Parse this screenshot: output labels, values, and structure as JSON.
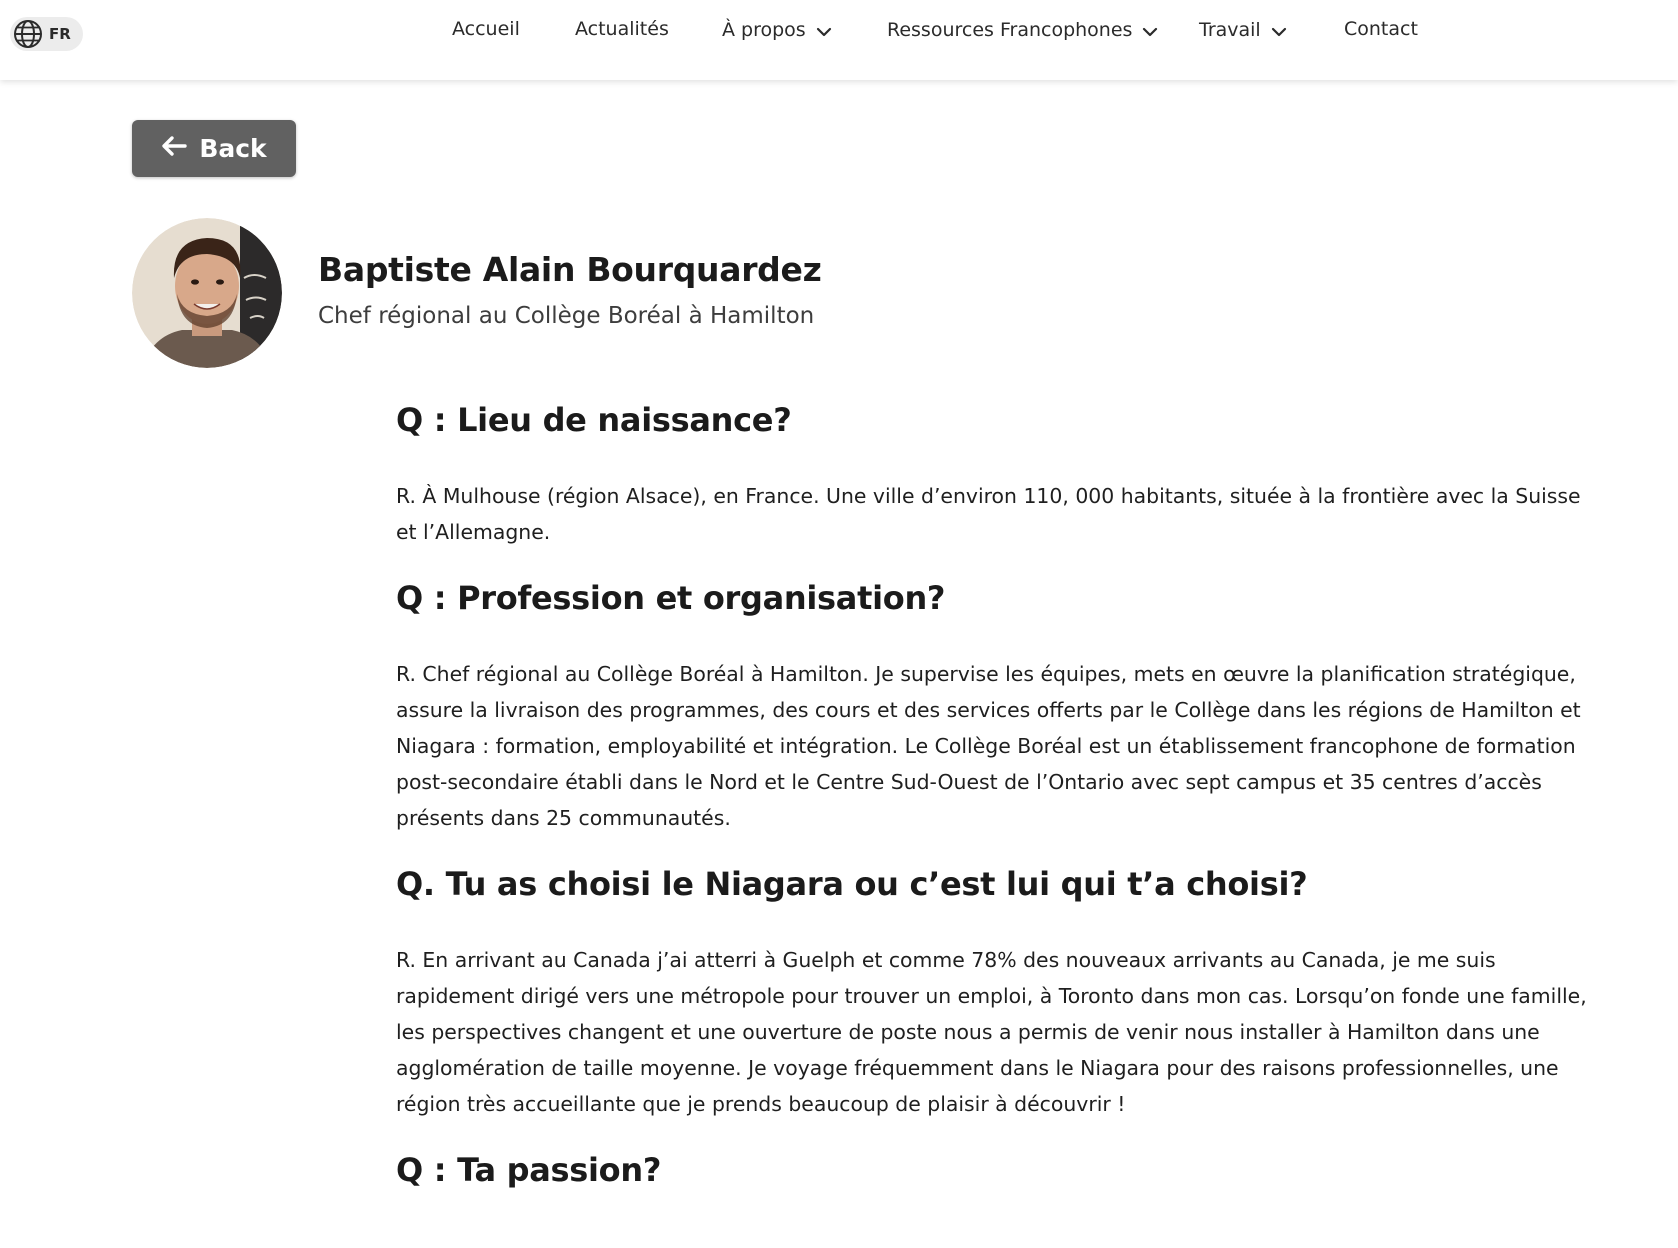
{
  "header": {
    "language": {
      "code": "FR",
      "icon": "globe-icon"
    },
    "nav": [
      {
        "label": "Accueil",
        "has_dropdown": false
      },
      {
        "label": "Actualités",
        "has_dropdown": false
      },
      {
        "label": "À propos",
        "has_dropdown": true
      },
      {
        "label": "Ressources Francophones",
        "has_dropdown": true
      },
      {
        "label": "Travail",
        "has_dropdown": true
      },
      {
        "label": "Contact",
        "has_dropdown": false
      }
    ]
  },
  "back_button": {
    "label": "Back",
    "icon": "arrow-left-icon"
  },
  "profile": {
    "name": "Baptiste Alain Bourquardez",
    "role": "Chef régional au Collège Boréal à Hamilton"
  },
  "qa": [
    {
      "question": "Q : Lieu de naissance?",
      "answer": "R. À Mulhouse (région Alsace), en France. Une ville d’environ 110, 000 habitants, située à la frontière avec la Suisse et l’Allemagne."
    },
    {
      "question": "Q : Profession et organisation?",
      "answer": "R. Chef régional au Collège Boréal à Hamilton. Je supervise les équipes, mets en œuvre la planification stratégique, assure la livraison des programmes, des cours et des services offerts par le Collège dans les régions de Hamilton et Niagara : formation, employabilité et intégration. Le Collège Boréal est un établissement francophone de formation post-secondaire établi dans le Nord et le Centre Sud-Ouest de l’Ontario avec sept campus et 35 centres d’accès présents dans 25 communautés."
    },
    {
      "question": "Q. Tu as choisi le Niagara ou c’est lui qui t’a choisi?",
      "answer": "R. En arrivant au Canada j’ai atterri à Guelph et comme 78% des nouveaux arrivants au Canada, je me suis rapidement dirigé vers une métropole pour trouver un emploi, à Toronto dans mon cas. Lorsqu’on fonde une famille, les perspectives changent et une ouverture de poste nous a permis de venir nous installer à Hamilton dans une agglomération de taille moyenne. Je voyage fréquemment dans le Niagara pour des raisons professionnelles, une région très accueillante que je prends beaucoup de plaisir à découvrir !"
    },
    {
      "question": "Q : Ta passion?",
      "answer": ""
    }
  ]
}
